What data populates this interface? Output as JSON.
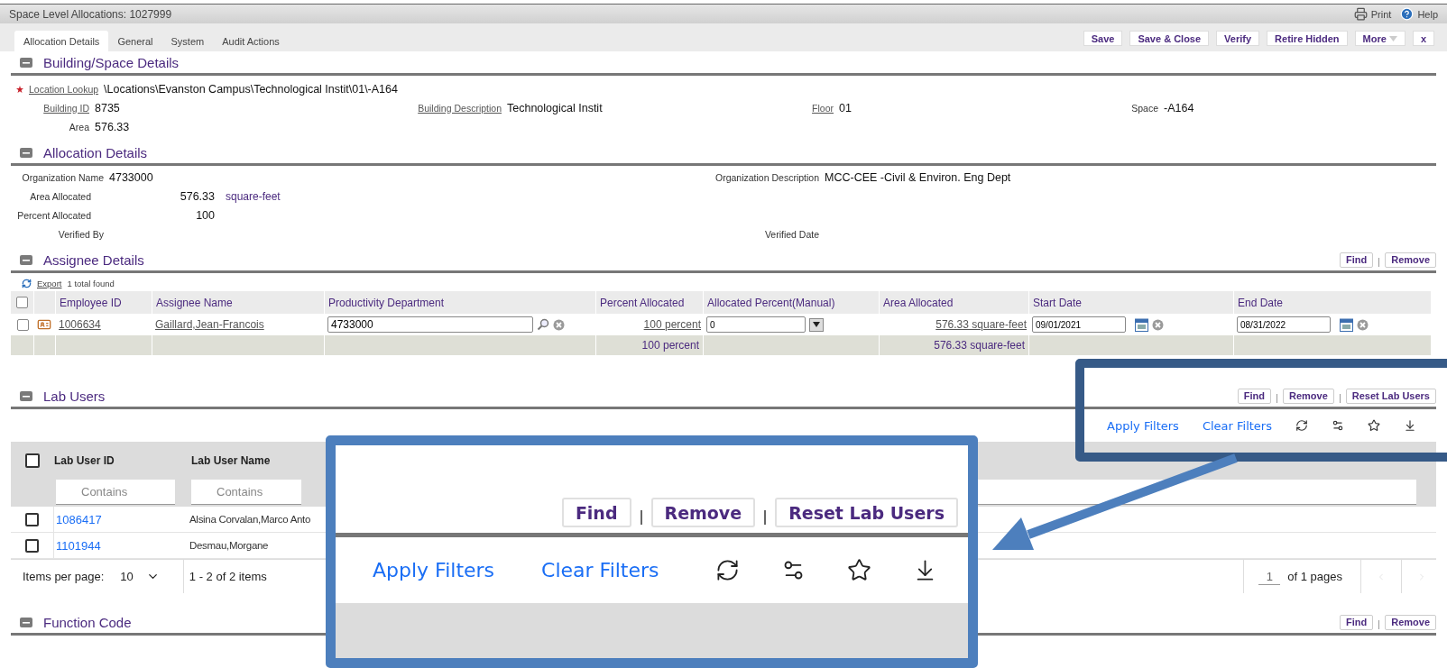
{
  "window": {
    "title": "Space Level Allocations: 1027999",
    "actions": [
      {
        "kind": "print",
        "label": "Print"
      },
      {
        "kind": "help",
        "label": "Help"
      }
    ]
  },
  "tabs": [
    {
      "label": "Allocation Details",
      "selected": true
    },
    {
      "label": "General",
      "selected": false
    },
    {
      "label": "System",
      "selected": false
    },
    {
      "label": "Audit Actions",
      "selected": false
    }
  ],
  "toolbar_buttons": [
    {
      "label": "Save",
      "caret": false
    },
    {
      "label": "Save & Close",
      "caret": false
    },
    {
      "label": "Verify",
      "caret": false
    },
    {
      "label": "Retire Hidden",
      "caret": false
    },
    {
      "label": "More",
      "caret": true
    },
    {
      "label": "x",
      "caret": false
    }
  ],
  "building_space": {
    "title": "Building/Space Details",
    "expanded": true,
    "location": {
      "label": "Location Lookup",
      "value": "\\Locations\\Evanston Campus\\Technological Instit\\01\\-A164",
      "required": true
    },
    "fields": [
      {
        "label": "Building ID",
        "value": "8735",
        "link": true
      },
      {
        "label": "Building Description",
        "value": "Technological Instit",
        "link": true
      },
      {
        "label": "Floor",
        "value": "01",
        "link": true
      },
      {
        "label": "Space",
        "value": "-A164",
        "link": false
      },
      {
        "label": "Area",
        "value": "576.33",
        "link": false
      }
    ]
  },
  "allocation": {
    "title": "Allocation Details",
    "expanded": true,
    "rows": [
      {
        "left": {
          "label": "Organization Name",
          "value": "4733000",
          "kind": "text"
        },
        "right": {
          "label": "Organization Description",
          "value": "MCC-CEE -Civil & Environ. Eng Dept"
        }
      },
      {
        "left": {
          "label": "Area Allocated",
          "value": "576.33",
          "unit": "square-feet",
          "kind": "measure"
        }
      },
      {
        "left": {
          "label": "Percent Allocated",
          "value": "100",
          "kind": "measure"
        }
      },
      {
        "left": {
          "label": "Verified By",
          "kind": "text"
        },
        "right": {
          "label": "Verified Date"
        }
      }
    ]
  },
  "assignees": {
    "title": "Assignee Details",
    "expanded": true,
    "buttons": [
      "Find",
      "Remove"
    ],
    "export": "Export",
    "count": "1 total found",
    "select_all": false,
    "columns": [
      "Employee ID",
      "Assignee Name",
      "Productivity Department",
      "Percent Allocated",
      "Allocated Percent(Manual)",
      "Area Allocated",
      "Start Date",
      "End Date"
    ],
    "rows": [
      {
        "checked": false,
        "employee_id": "1006634",
        "name": "Gaillard,Jean-Francois",
        "department": "4733000",
        "percent": "100 percent",
        "manual": "0",
        "area": "576.33 square-feet",
        "start": "09/01/2021",
        "end": "08/31/2022"
      }
    ],
    "totals": {
      "percent": "100 percent",
      "area": "576.33 square-feet"
    }
  },
  "lab_users": {
    "title": "Lab Users",
    "expanded": true,
    "buttons": [
      "Find",
      "Remove",
      "Reset Lab Users"
    ],
    "filter_actions": [
      "Apply Filters",
      "Clear Filters"
    ],
    "select_all": false,
    "columns": [
      "Lab User ID",
      "Lab User Name"
    ],
    "filter_placeholders": [
      "Contains",
      "Contains"
    ],
    "rows": [
      {
        "checked": false,
        "id": "1086417",
        "name": "Alsina Corvalan,Marco Anto"
      },
      {
        "checked": false,
        "id": "1101944",
        "name": "Desmau,Morgane"
      }
    ],
    "footer": {
      "per_page_label": "Items per page:",
      "per_page": "10",
      "range": "1 - 2 of 2 items",
      "page": "1",
      "page_total": "of 1 pages"
    }
  },
  "function_code": {
    "title": "Function Code",
    "expanded": true,
    "buttons": [
      "Find",
      "Remove"
    ]
  },
  "callout": {
    "buttons": [
      "Find",
      "Remove",
      "Reset Lab Users"
    ],
    "filter_actions": [
      "Apply Filters",
      "Clear Filters"
    ]
  }
}
